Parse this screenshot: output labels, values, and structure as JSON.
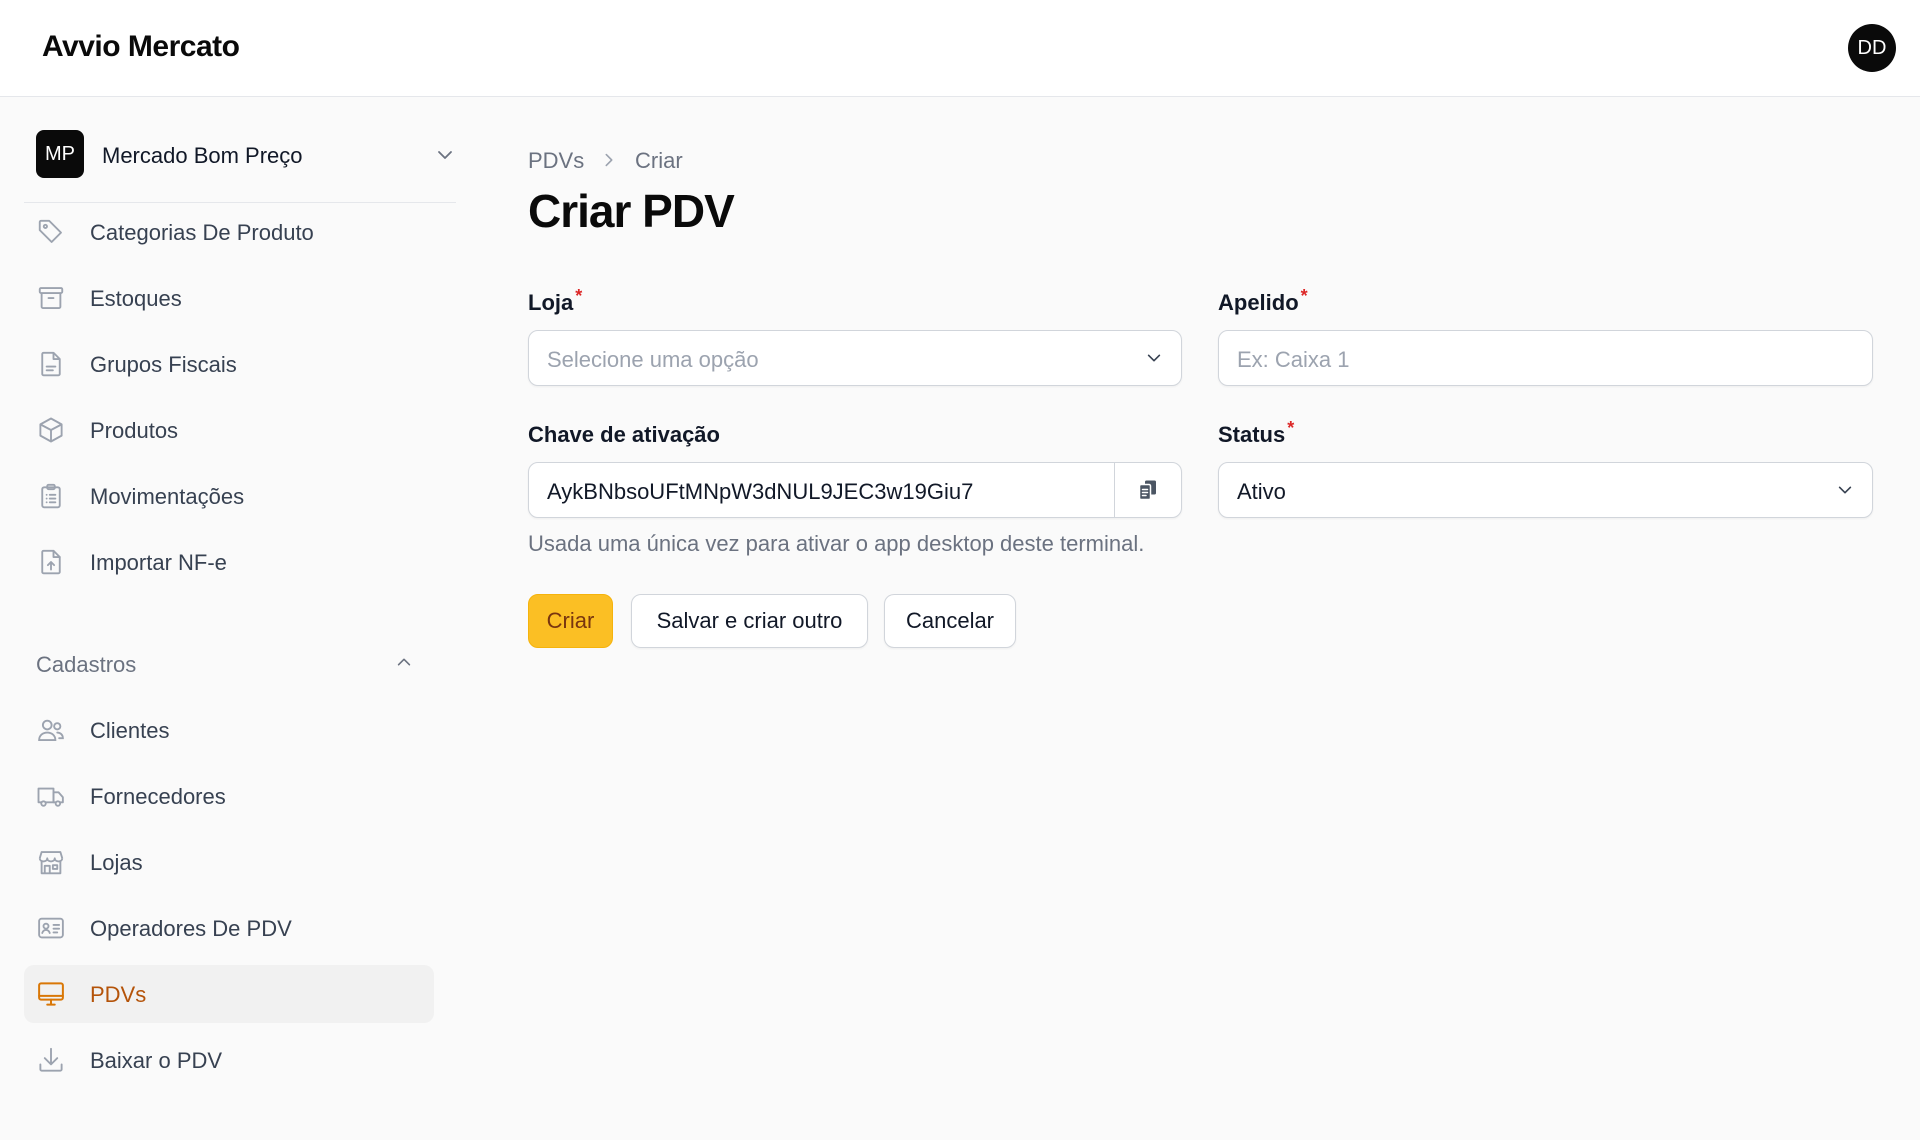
{
  "app": {
    "brand": "Avvio Mercato",
    "user_initials": "DD"
  },
  "sidebar": {
    "tenant": {
      "initials": "MP",
      "name": "Mercado Bom Preço"
    },
    "items": [
      {
        "label": "Categorias De Produto",
        "icon": "tag-icon"
      },
      {
        "label": "Estoques",
        "icon": "archive-box-icon"
      },
      {
        "label": "Grupos Fiscais",
        "icon": "document-icon"
      },
      {
        "label": "Produtos",
        "icon": "cube-icon"
      },
      {
        "label": "Movimentações",
        "icon": "clipboard-list-icon"
      },
      {
        "label": "Importar NF-e",
        "icon": "document-upload-icon"
      }
    ],
    "group": {
      "label": "Cadastros",
      "expanded": true,
      "items": [
        {
          "label": "Clientes",
          "icon": "users-icon"
        },
        {
          "label": "Fornecedores",
          "icon": "truck-icon"
        },
        {
          "label": "Lojas",
          "icon": "storefront-icon"
        },
        {
          "label": "Operadores De PDV",
          "icon": "id-card-icon"
        },
        {
          "label": "PDVs",
          "icon": "monitor-icon",
          "active": true
        },
        {
          "label": "Baixar o PDV",
          "icon": "download-icon"
        }
      ]
    }
  },
  "breadcrumb": {
    "parent": "PDVs",
    "current": "Criar"
  },
  "page": {
    "title": "Criar PDV"
  },
  "form": {
    "loja": {
      "label": "Loja",
      "placeholder": "Selecione uma opção"
    },
    "apelido": {
      "label": "Apelido",
      "placeholder": "Ex: Caixa 1",
      "value": ""
    },
    "chave": {
      "label": "Chave de ativação",
      "value": "AykBNbsoUFtMNpW3dNUL9JEC3w19Giu7",
      "helper": "Usada uma única vez para ativar o app desktop deste terminal."
    },
    "status": {
      "label": "Status",
      "value": "Ativo"
    },
    "required_mark": "*"
  },
  "actions": {
    "create": "Criar",
    "save_and_create_another": "Salvar e criar outro",
    "cancel": "Cancelar"
  },
  "colors": {
    "accent": "#fbbf24",
    "active_nav_text": "#b45309",
    "required": "#dc2626"
  }
}
